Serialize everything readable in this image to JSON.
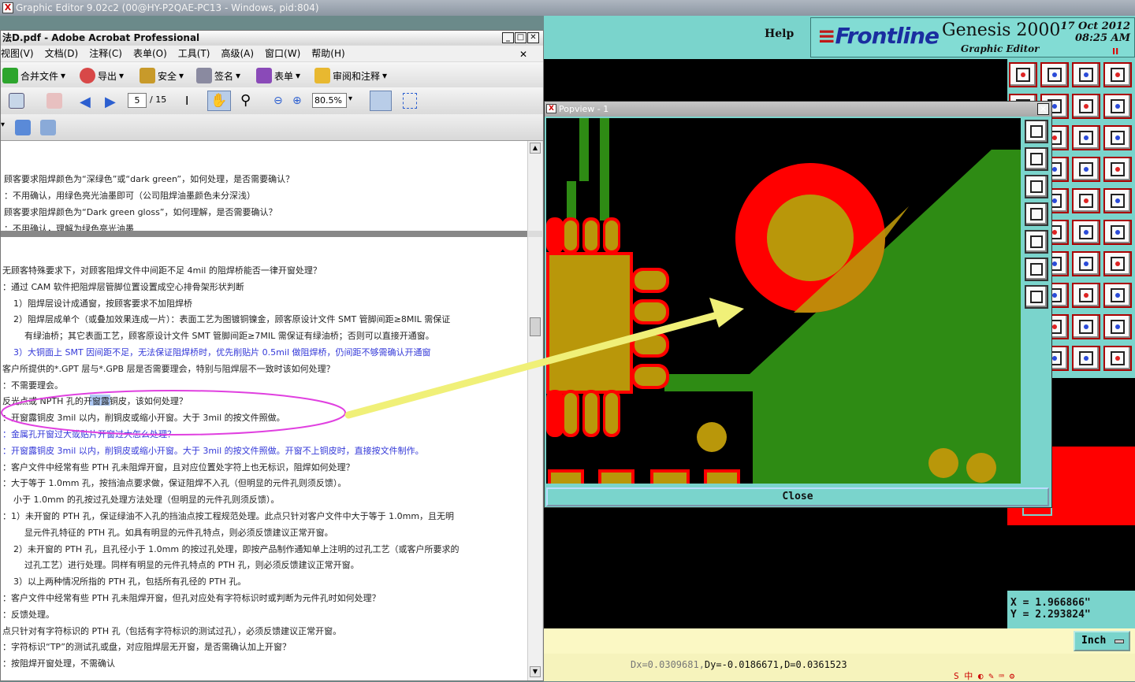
{
  "main_window": {
    "title": "Graphic Editor 9.02c2 (00@HY-P2QAE-PC13 - Windows, pid:804)"
  },
  "genesis": {
    "help_label": "Help",
    "logo": "Frontline",
    "product": "Genesis 2000",
    "subtitle": "Graphic Editor",
    "date": "17 Oct 2012",
    "time": "08:25 AM",
    "pause_glyph": "II",
    "coord_x": "X = 1.966866\"",
    "coord_y": "Y = 2.293824\"",
    "units_label": "Inch",
    "status_cut": "Dx=0.0309681,",
    "status_text": "Dy=-0.0186671,D=0.0361523"
  },
  "acrobat": {
    "title": "法D.pdf - Adobe Acrobat Professional",
    "menu": [
      "视图(V)",
      "文档(D)",
      "注释(C)",
      "表单(O)",
      "工具(T)",
      "高级(A)",
      "窗口(W)",
      "帮助(H)"
    ],
    "toolbar": {
      "merge": "合并文件",
      "export": "导出",
      "security": "安全",
      "sign": "签名",
      "forms": "表单",
      "review": "审阅和注释"
    },
    "page_current": "5",
    "page_total": "/ 15",
    "zoom": "80.5%",
    "doc_top_lines": [
      "顾客要求阻焊颜色为“深绿色”或“dark green”，如何处理，是否需要确认？",
      "：不用确认，用绿色亮光油墨即可（公司阻焊油墨颜色未分深浅）",
      "顾客要求阻焊颜色为“Dark green gloss”，如何理解，是否需要确认？",
      "：不用确认，理解为绿色亮光油墨"
    ],
    "doc_lines": [
      {
        "t": "无顾客特殊要求下，对顾客阻焊文件中间距不足 4mil 的阻焊桥能否一律开窗处理？",
        "c": ""
      },
      {
        "t": "：通过 CAM 软件把阻焊层管脚位置设置成空心排骨架形状判断",
        "c": ""
      },
      {
        "t": "1）阻焊层设计成通窗，按顾客要求不加阻焊桥",
        "c": "",
        "i": 1
      },
      {
        "t": "2）阻焊层成单个（或叠加效果连成一片）：表面工艺为图镀铜镍金，顾客原设计文件 SMT 管脚间距≥8MIL 需保证",
        "c": "",
        "i": 1
      },
      {
        "t": "有绿油桥；其它表面工艺，顾客原设计文件 SMT 管脚间距≥7MIL 需保证有绿油桥；否则可以直接开通窗。",
        "c": "",
        "i": 2
      },
      {
        "t": "3）大铜面上 SMT 因间距不足，无法保证阻焊桥时，优先削贴片 0.5mil 做阻焊桥，仍间距不够需确认开通窗",
        "c": "blue",
        "i": 1
      },
      {
        "t": "客户所提供的*.GPT 层与*.GPB 层是否需要理会，特别与阻焊层不一致时该如何处理？",
        "c": ""
      },
      {
        "t": "：不需要理会。",
        "c": ""
      },
      {
        "t": "反光点或 NPTH 孔的开窗露铜皮，该如何处理？",
        "c": ""
      },
      {
        "t": "：开窗露铜皮 3mil 以内，削铜皮或缩小开窗。大于 3mil 的按文件照做。",
        "c": ""
      },
      {
        "t": "：金属孔开窗过大或贴片开窗过大怎么处理？",
        "c": "blue"
      },
      {
        "t": "：开窗露铜皮 3mil 以内，削铜皮或缩小开窗。大于 3mil 的按文件照做。开窗不上铜皮时，直接按文件制作。",
        "c": "blue"
      },
      {
        "t": "：客户文件中经常有些 PTH 孔未阻焊开窗，且对应位置处字符上也无标识，阻焊如何处理？",
        "c": ""
      },
      {
        "t": "：大于等于 1.0mm 孔，按挡油点要求做，保证阻焊不入孔（但明显的元件孔则须反馈）。",
        "c": ""
      },
      {
        "t": "小于 1.0mm 的孔按过孔处理方法处理（但明显的元件孔则须反馈）。",
        "c": "",
        "i": 1
      },
      {
        "t": "：1）未开窗的 PTH 孔，保证绿油不入孔的挡油点按工程规范处理。此点只针对客户文件中大于等于 1.0mm，且无明",
        "c": ""
      },
      {
        "t": "显元件孔特征的 PTH 孔。如具有明显的元件孔特点，则必须反馈建议正常开窗。",
        "c": "",
        "i": 2
      },
      {
        "t": "2）未开窗的 PTH 孔，且孔径小于 1.0mm 的按过孔处理，即按产品制作通知单上注明的过孔工艺（或客户所要求的",
        "c": "",
        "i": 1
      },
      {
        "t": "过孔工艺）进行处理。同样有明显的元件孔特点的 PTH 孔，则必须反馈建议正常开窗。",
        "c": "",
        "i": 2
      },
      {
        "t": "3）以上两种情况所指的 PTH 孔，包括所有孔径的 PTH 孔。",
        "c": "",
        "i": 1
      },
      {
        "t": "：客户文件中经常有些 PTH 孔未阻焊开窗，但孔对应处有字符标识时或判断为元件孔时如何处理？",
        "c": ""
      },
      {
        "t": "：反馈处理。",
        "c": ""
      },
      {
        "t": "点只针对有字符标识的 PTH 孔（包括有字符标识的测试过孔），必须反馈建议正常开窗。",
        "c": ""
      },
      {
        "t": "：字符标识“TP”的测试孔或盘，对应阻焊层无开窗，是否需确认加上开窗？",
        "c": ""
      },
      {
        "t": "：按阻焊开窗处理，不需确认",
        "c": ""
      }
    ]
  },
  "popview": {
    "title": "Popview - 1",
    "close_label": "Close"
  },
  "colors": {
    "copper_green": "#2e8b14",
    "pad_gold": "#b9970a",
    "soldermask_red": "#ff0000",
    "genesis_teal": "#7ad4cc"
  }
}
